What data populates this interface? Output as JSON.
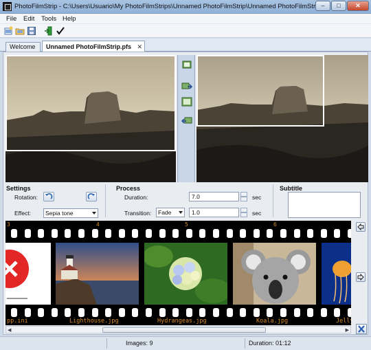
{
  "window": {
    "title": "PhotoFilmStrip - C:\\Users\\Usuario\\My PhotoFilmStrips\\Unnamed PhotoFilmStrip\\Unnamed PhotoFilmStrip...",
    "minimize": "–",
    "maximize": "□",
    "close": "✕"
  },
  "menu": {
    "file": "File",
    "edit": "Edit",
    "tools": "Tools",
    "help": "Help"
  },
  "tabs": [
    {
      "label": "Welcome"
    },
    {
      "label": "Unnamed PhotoFilmStrip.pfs",
      "close": "✕"
    }
  ],
  "settings": {
    "heading": "Settings",
    "rotation_label": "Rotation:",
    "effect_label": "Effect:",
    "effect_value": "Sepia tone"
  },
  "process": {
    "heading": "Process",
    "duration_label": "Duration:",
    "duration_value": "7.0",
    "duration_unit": "sec",
    "transition_label": "Transition:",
    "transition_type": "Fade",
    "transition_value": "1.0",
    "transition_unit": "sec"
  },
  "subtitle": {
    "heading": "Subtitle"
  },
  "filmstrip": {
    "frame_numbers": [
      "3",
      "4",
      "5",
      "6"
    ],
    "files": [
      "pp.ini",
      "Lighthouse.jpg",
      "Hydrangeas.jpg",
      "Koala.jpg",
      "Jelly"
    ]
  },
  "status": {
    "images": "Images: 9",
    "duration": "Duration: 01:12"
  },
  "colors": {
    "accent": "#cfdbe9",
    "film_text": "#d78a2c",
    "selection": "#ffffff"
  }
}
